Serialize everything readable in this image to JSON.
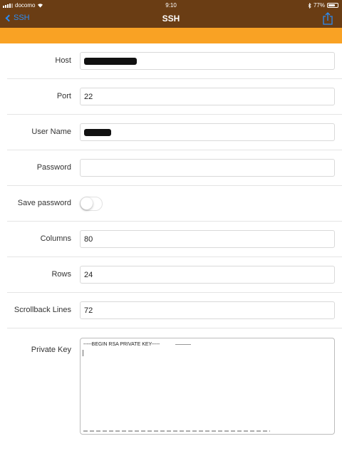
{
  "status_bar": {
    "carrier": "docomo",
    "time": "9:10",
    "battery_text": "77%",
    "battery_level": 0.77
  },
  "nav": {
    "back_label": "SSH",
    "title": "SSH",
    "share_icon": "share-icon"
  },
  "colors": {
    "nav_background": "#6a3d14",
    "accent_band": "#f9a224",
    "link": "#2a8cf5"
  },
  "form": {
    "host": {
      "label": "Host",
      "value": ""
    },
    "port": {
      "label": "Port",
      "value": "22"
    },
    "user_name": {
      "label": "User Name",
      "value": ""
    },
    "password": {
      "label": "Password",
      "value": ""
    },
    "save_password": {
      "label": "Save password",
      "on": false
    },
    "columns": {
      "label": "Columns",
      "value": "80"
    },
    "rows": {
      "label": "Rows",
      "value": "24"
    },
    "scrollback": {
      "label": "Scrollback Lines",
      "value": "72"
    },
    "private_key": {
      "label": "Private Key",
      "first_line": "-----BEGIN RSA PRIVATE KEY-----"
    }
  }
}
